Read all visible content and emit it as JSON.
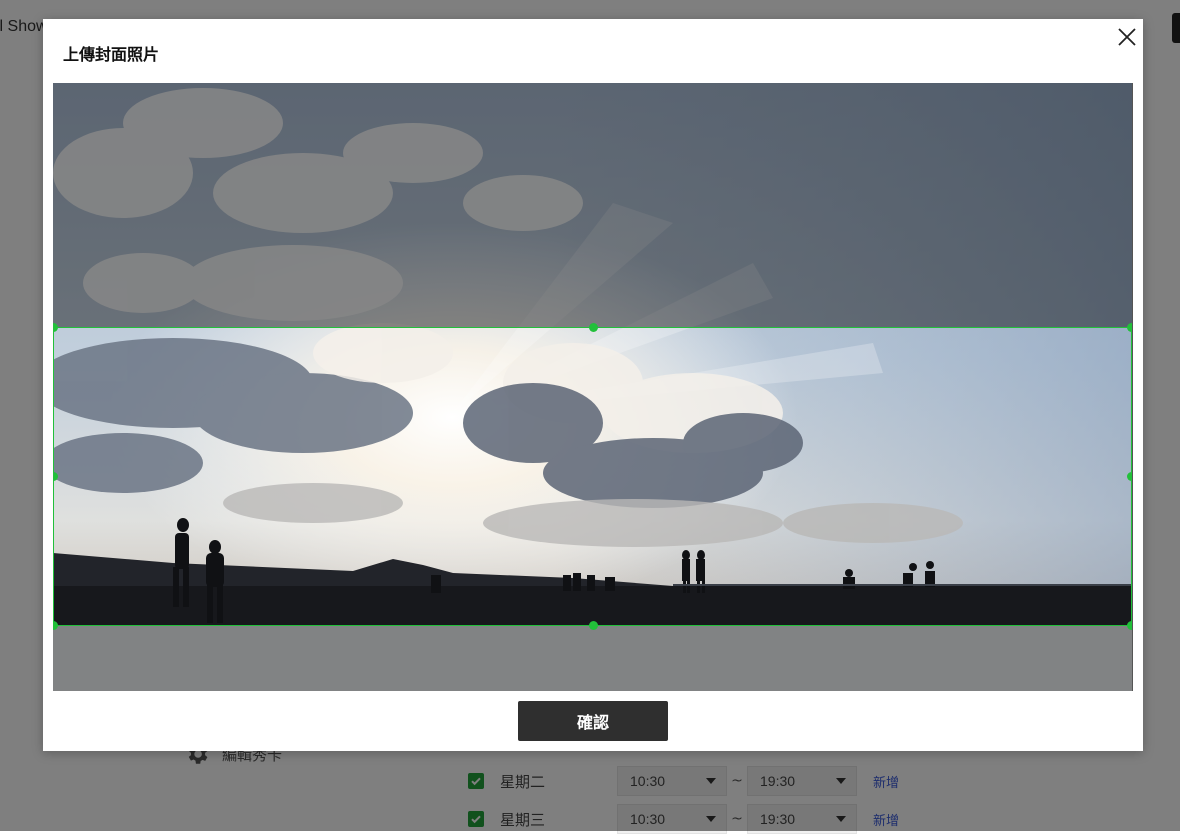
{
  "background": {
    "brand": "ll Show",
    "menu_label": "編輯秀卡",
    "schedule": [
      {
        "day": "星期二",
        "start": "10:30",
        "end": "19:30",
        "add": "新增",
        "checked": true
      },
      {
        "day": "星期三",
        "start": "10:30",
        "end": "19:30",
        "add": "新增",
        "checked": true
      }
    ],
    "separator": "~"
  },
  "modal": {
    "title": "上傳封面照片",
    "confirm_label": "確認"
  },
  "colors": {
    "accent_green": "#22c03a",
    "checkbox_green": "#22a33a",
    "link_blue": "#3b5bdb",
    "button_dark": "#2f2f2f",
    "overlay": "rgba(0,0,0,0.5)"
  },
  "icons": [
    "close-icon",
    "gear-icon",
    "checkmark-icon",
    "dropdown-caret-icon",
    "crop-handle"
  ]
}
